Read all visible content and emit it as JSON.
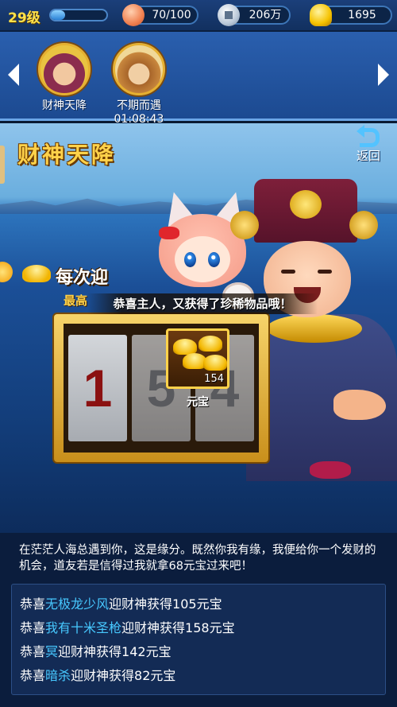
{
  "status_bar": {
    "level": "29级",
    "xp_fraction": 0.25,
    "stamina": "70/100",
    "silver": "206万",
    "gold": "1695",
    "icons": [
      "peach-icon",
      "silver-coin-icon",
      "gold-ingot-icon"
    ]
  },
  "activities": [
    {
      "label": "财神天降",
      "timer": ""
    },
    {
      "label": "不期而遇",
      "timer": "01:08:43"
    }
  ],
  "page": {
    "title": "财神天降",
    "back_label": "返回"
  },
  "event": {
    "banner_text": "每次迎",
    "max_label": "最高",
    "congrats": "恭喜主人，又获得了珍稀物品哦！",
    "reels": [
      "1",
      "5",
      "4"
    ]
  },
  "reward": {
    "count": "154",
    "label": "元宝"
  },
  "intro": "在茫茫人海总遇到你，这是缘分。既然你我有缘，我便给你一个发财的机会，道友若是信得过我就拿68元宝过来吧！",
  "log": [
    {
      "prefix": "恭喜",
      "name": "无极龙少风",
      "suffix": "迎财神获得105元宝"
    },
    {
      "prefix": "恭喜",
      "name": "我有十米圣枪",
      "suffix": "迎财神获得158元宝"
    },
    {
      "prefix": "恭喜",
      "name": "冥",
      "suffix": "迎财神获得142元宝"
    },
    {
      "prefix": "恭喜",
      "name": "暗杀",
      "suffix": "迎财神获得82元宝"
    }
  ],
  "colors": {
    "accent_gold": "#ffd24a",
    "player_name": "#47c8ff",
    "panel_bg": "#0b1d3d"
  }
}
